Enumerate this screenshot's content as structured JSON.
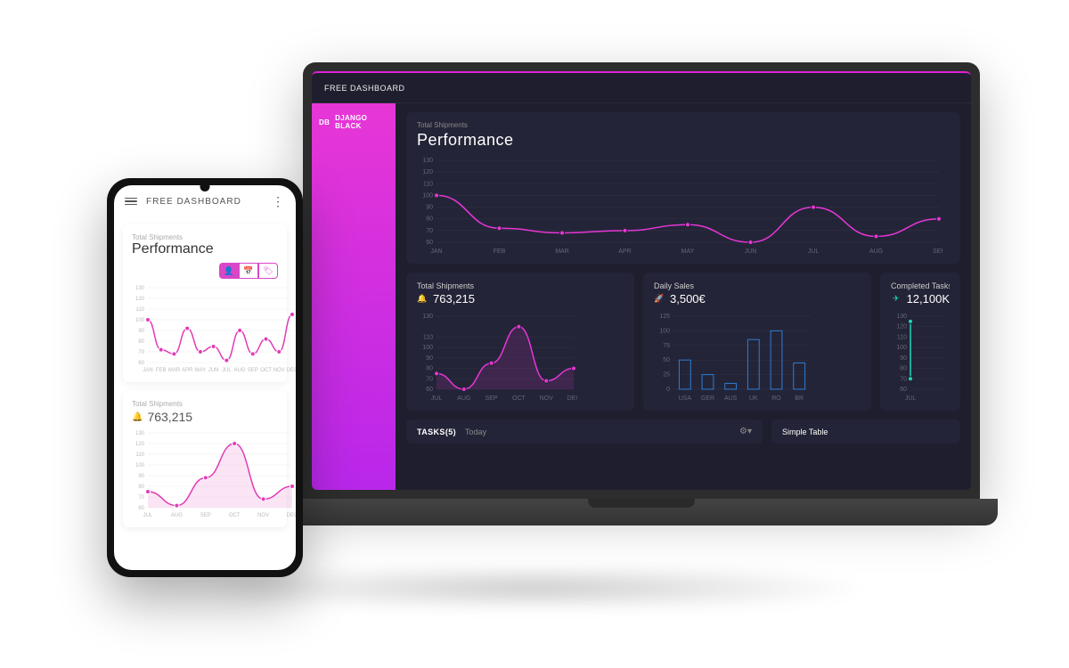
{
  "app_title": "FREE DASHBOARD",
  "sidebar": {
    "badge": "DB",
    "label": "DJANGO BLACK"
  },
  "hero": {
    "sub": "Total Shipments",
    "title": "Performance"
  },
  "card_shipments": {
    "sub": "Total Shipments",
    "value": "763,215"
  },
  "card_sales": {
    "sub": "Daily Sales",
    "value": "3,500€"
  },
  "card_tasks": {
    "sub": "Completed Tasks",
    "value": "12,100K"
  },
  "tasks_bar": {
    "label": "TASKS(5)",
    "filter": "Today",
    "simple": "Simple Table"
  },
  "phone": {
    "title": "FREE DASHBOARD",
    "perf_sub": "Total Shipments",
    "perf_title": "Performance",
    "ship_sub": "Total Shipments",
    "ship_value": "763,215"
  },
  "chart_data": [
    {
      "id": "desktop_performance",
      "type": "line",
      "categories": [
        "JAN",
        "FEB",
        "MAR",
        "APR",
        "MAY",
        "JUN",
        "JUL",
        "AUG",
        "SEP"
      ],
      "values": [
        100,
        72,
        68,
        70,
        75,
        60,
        90,
        65,
        80
      ],
      "ylim": [
        60,
        130
      ],
      "yticks": [
        60,
        70,
        80,
        90,
        100,
        110,
        120,
        130
      ],
      "color": "#e736d6"
    },
    {
      "id": "desktop_shipments",
      "type": "area",
      "categories": [
        "JUL",
        "AUG",
        "SEP",
        "OCT",
        "NOV",
        "DEC"
      ],
      "values": [
        75,
        60,
        85,
        120,
        68,
        80
      ],
      "ylim": [
        60,
        130
      ],
      "yticks": [
        60,
        70,
        80,
        90,
        100,
        110,
        130
      ],
      "color": "#e736d6"
    },
    {
      "id": "desktop_sales",
      "type": "bar",
      "categories": [
        "USA",
        "GER",
        "AUS",
        "UK",
        "RO",
        "BR"
      ],
      "values": [
        50,
        25,
        10,
        85,
        100,
        45
      ],
      "ylim": [
        0,
        125
      ],
      "yticks": [
        0,
        25,
        50,
        75,
        100,
        125
      ],
      "color": "#2b7dd6"
    },
    {
      "id": "desktop_completed",
      "type": "line",
      "categories": [
        "JUL"
      ],
      "values": [
        125,
        70
      ],
      "ylim": [
        60,
        130
      ],
      "yticks": [
        60,
        70,
        80,
        90,
        100,
        110,
        120,
        130
      ],
      "color": "#1fd6b5"
    },
    {
      "id": "mobile_performance",
      "type": "line",
      "categories": [
        "JAN",
        "FEB",
        "MAR",
        "APR",
        "MAY",
        "JUN",
        "JUL",
        "AUG",
        "SEP",
        "OCT",
        "NOV",
        "DEC"
      ],
      "values": [
        100,
        72,
        68,
        92,
        70,
        75,
        62,
        90,
        68,
        82,
        70,
        105
      ],
      "ylim": [
        60,
        130
      ],
      "yticks": [
        60,
        70,
        80,
        90,
        100,
        110,
        120,
        130
      ],
      "color": "#e23bb6"
    },
    {
      "id": "mobile_shipments",
      "type": "area",
      "categories": [
        "JUL",
        "AUG",
        "SEP",
        "OCT",
        "NOV",
        "DEC"
      ],
      "values": [
        75,
        62,
        88,
        120,
        68,
        80
      ],
      "ylim": [
        60,
        130
      ],
      "yticks": [
        60,
        70,
        80,
        90,
        100,
        110,
        120,
        130
      ],
      "color": "#e23bb6"
    }
  ]
}
